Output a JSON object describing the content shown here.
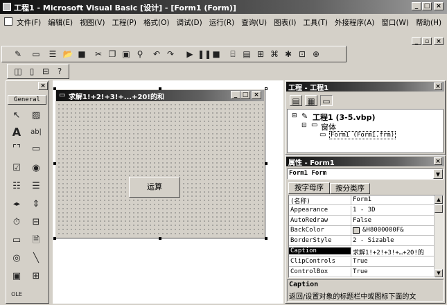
{
  "window": {
    "title": "工程1 - Microsoft Visual Basic [设计] - [Form1 (Form)]"
  },
  "menu": [
    "文件(F)",
    "编辑(E)",
    "视图(V)",
    "工程(P)",
    "格式(O)",
    "调试(D)",
    "运行(R)",
    "查询(U)",
    "图表(I)",
    "工具(T)",
    "外接程序(A)",
    "窗口(W)",
    "帮助(H)"
  ],
  "toolbox": {
    "tab": "General"
  },
  "form": {
    "title": "求解1!+2!+3!+...+20!的和",
    "button_label": "运算"
  },
  "project": {
    "title": "工程 - 工程1",
    "root": "工程1 (3-5.vbp)",
    "folder": "窗体",
    "item": "Form1 (Form1.frm)"
  },
  "properties": {
    "title": "属性 - Form1",
    "object": "Form1 Form",
    "tabs": [
      "按字母序",
      "按分类序"
    ],
    "rows": [
      {
        "name": "(名称)",
        "value": "Form1"
      },
      {
        "name": "Appearance",
        "value": "1 - 3D"
      },
      {
        "name": "AutoRedraw",
        "value": "False"
      },
      {
        "name": "BackColor",
        "value": "&H8000000F&"
      },
      {
        "name": "BorderStyle",
        "value": "2 - Sizable"
      },
      {
        "name": "Caption",
        "value": "求解1!+2!+3!+…+20!的"
      },
      {
        "name": "ClipControls",
        "value": "True"
      },
      {
        "name": "ControlBox",
        "value": "True"
      }
    ],
    "selected_row": 5,
    "desc_title": "Caption",
    "desc_text": "返回/设置对象的标题栏中或图标下面的文"
  },
  "colors": {
    "selection": "#000000",
    "form_bg": "#d4d0c8"
  }
}
